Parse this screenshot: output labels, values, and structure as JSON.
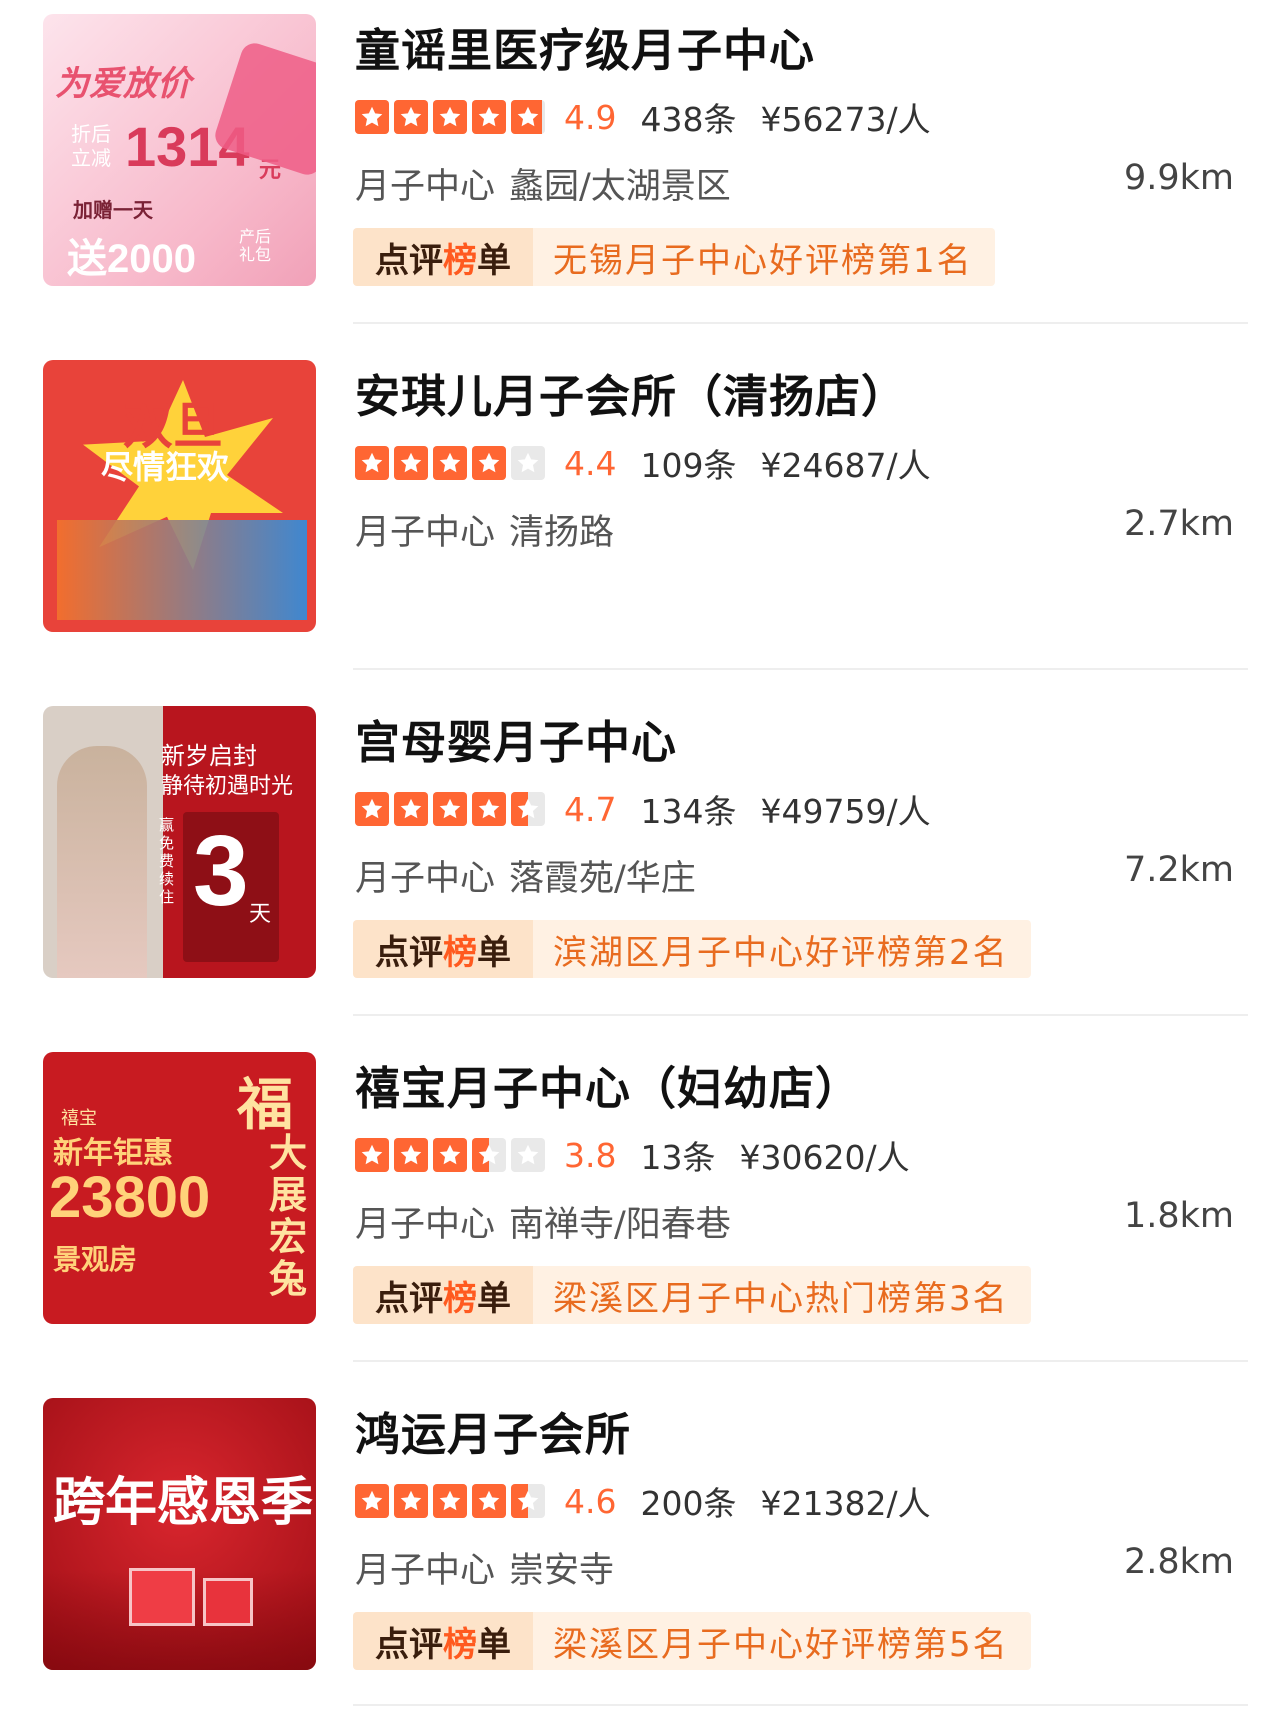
{
  "colors": {
    "accent": "#ff6633",
    "rank_tag_bg": "#fde3c9",
    "rank_text": "#e86b1f"
  },
  "items": [
    {
      "name": "童谣里医疗级月子中心",
      "score": "4.9",
      "stars": 4.9,
      "reviews": "438条",
      "price": "¥56273/人",
      "category": "月子中心",
      "area": "蠡园/太湖景区",
      "distance": "9.9km",
      "rank_tag": "点评榜单",
      "rank_text": "无锡月子中心好评榜第1名",
      "thumb": {
        "t1": "为爱放价",
        "t2": "折后立减",
        "t3": "1314",
        "t4": "元",
        "t5": "加赠一天",
        "t6": "送2000",
        "t7": "产后礼包"
      }
    },
    {
      "name": "安琪儿月子会所（清扬店）",
      "score": "4.4",
      "stars": 4.0,
      "reviews": "109条",
      "price": "¥24687/人",
      "category": "月子中心",
      "area": "清扬路",
      "distance": "2.7km",
      "rank_tag": "",
      "rank_text": "",
      "thumb": {
        "t1": "双旦",
        "t2": "尽情狂欢"
      }
    },
    {
      "name": "宫母婴月子中心",
      "score": "4.7",
      "stars": 4.5,
      "reviews": "134条",
      "price": "¥49759/人",
      "category": "月子中心",
      "area": "落霞苑/华庄",
      "distance": "7.2km",
      "rank_tag": "点评榜单",
      "rank_text": "滨湖区月子中心好评榜第2名",
      "thumb": {
        "t1": "新岁启封",
        "t2": "静待初遇时光",
        "t3": "3",
        "t4": "天",
        "t5": "赢免费续住"
      }
    },
    {
      "name": "禧宝月子中心（妇幼店）",
      "score": "3.8",
      "stars": 3.5,
      "reviews": "13条",
      "price": "¥30620/人",
      "category": "月子中心",
      "area": "南禅寺/阳春巷",
      "distance": "1.8km",
      "rank_tag": "点评榜单",
      "rank_text": "梁溪区月子中心热门榜第3名",
      "thumb": {
        "t1": "福",
        "t2": "禧宝",
        "t3": "新年钜惠",
        "t4": "23800",
        "t5": "景观房",
        "t6": "大展宏兔"
      }
    },
    {
      "name": "鸿运月子会所",
      "score": "4.6",
      "stars": 4.5,
      "reviews": "200条",
      "price": "¥21382/人",
      "category": "月子中心",
      "area": "崇安寺",
      "distance": "2.8km",
      "rank_tag": "点评榜单",
      "rank_text": "梁溪区月子中心好评榜第5名",
      "thumb": {
        "t1": "跨年感恩季"
      }
    }
  ]
}
